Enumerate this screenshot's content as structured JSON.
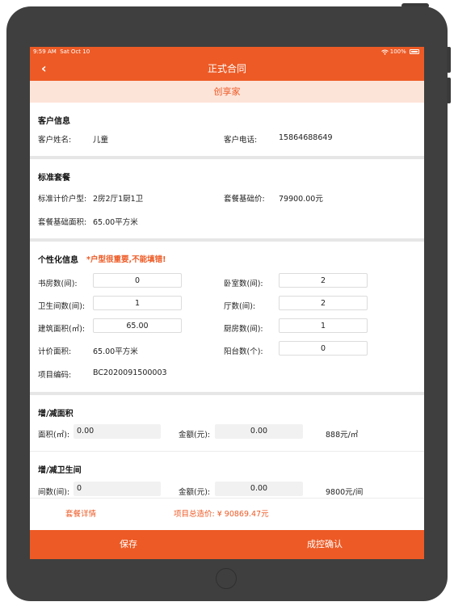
{
  "status_bar": {
    "time": "9:59 AM",
    "date": "Sat Oct 10",
    "battery": "100%"
  },
  "nav": {
    "title": "正式合同"
  },
  "banner": {
    "text": "创享家"
  },
  "customer": {
    "heading": "客户信息",
    "name_label": "客户姓名:",
    "name_value": "儿童",
    "phone_label": "客户电话:",
    "phone_value": "15864688649"
  },
  "package": {
    "heading": "标准套餐",
    "type_label": "标准计价户型:",
    "type_value": "2房2厅1厨1卫",
    "price_label": "套餐基础价:",
    "price_value": "79900.00元",
    "area_label": "套餐基础面积:",
    "area_value": "65.00平方米"
  },
  "custom": {
    "heading": "个性化信息",
    "warning": "*户型很重要,不能填错!",
    "study_label": "书房数(间):",
    "study_value": "0",
    "bedroom_label": "卧室数(间):",
    "bedroom_value": "2",
    "bath_label": "卫生间数(间):",
    "bath_value": "1",
    "hall_label": "厅数(间):",
    "hall_value": "2",
    "build_area_label": "建筑面积(㎡):",
    "build_area_value": "65.00",
    "kitchen_label": "厨房数(间):",
    "kitchen_value": "1",
    "calc_area_label": "计价面积:",
    "calc_area_value": "65.00平方米",
    "balcony_label": "阳台数(个):",
    "balcony_value": "0",
    "code_label": "项目编码:",
    "code_value": "BC2020091500003"
  },
  "add_area": {
    "heading": "增/减面积",
    "area_label": "面积(㎡):",
    "area_value": "0.00",
    "amount_label": "金额(元):",
    "amount_value": "0.00",
    "unit_price": "888元/㎡"
  },
  "add_bath": {
    "heading": "增/减卫生间",
    "count_label": "间数(间):",
    "count_value": "0",
    "amount_label": "金额(元):",
    "amount_value": "0.00",
    "unit_price": "9800元/间"
  },
  "footer": {
    "details_link": "套餐详情",
    "total": "项目总造价: ¥ 90869.47元",
    "save": "保存",
    "confirm": "成控确认"
  },
  "colors": {
    "accent": "#ed5a25",
    "banner_bg": "#fde4d9",
    "device": "#3f3f3f"
  }
}
